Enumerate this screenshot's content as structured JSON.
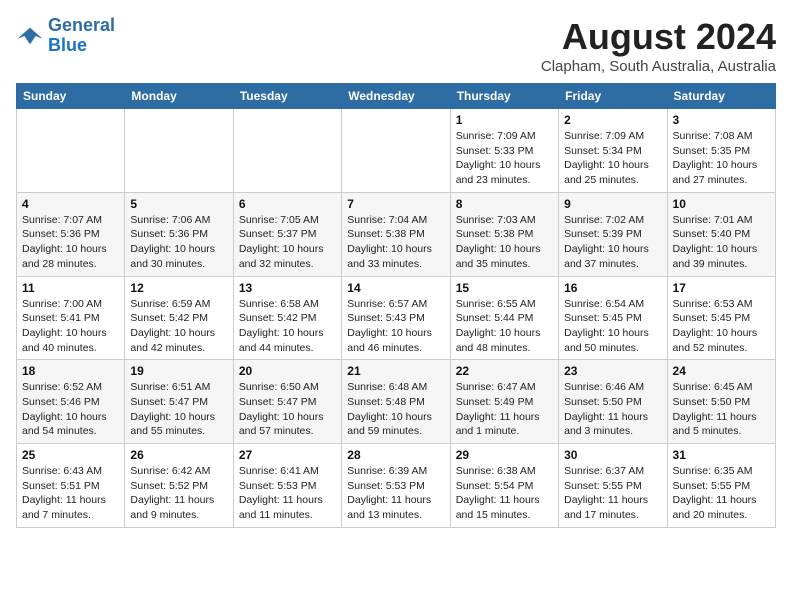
{
  "header": {
    "logo": {
      "line1": "General",
      "line2": "Blue"
    },
    "month": "August 2024",
    "location": "Clapham, South Australia, Australia"
  },
  "weekdays": [
    "Sunday",
    "Monday",
    "Tuesday",
    "Wednesday",
    "Thursday",
    "Friday",
    "Saturday"
  ],
  "weeks": [
    [
      {
        "day": "",
        "info": ""
      },
      {
        "day": "",
        "info": ""
      },
      {
        "day": "",
        "info": ""
      },
      {
        "day": "",
        "info": ""
      },
      {
        "day": "1",
        "info": "Sunrise: 7:09 AM\nSunset: 5:33 PM\nDaylight: 10 hours\nand 23 minutes."
      },
      {
        "day": "2",
        "info": "Sunrise: 7:09 AM\nSunset: 5:34 PM\nDaylight: 10 hours\nand 25 minutes."
      },
      {
        "day": "3",
        "info": "Sunrise: 7:08 AM\nSunset: 5:35 PM\nDaylight: 10 hours\nand 27 minutes."
      }
    ],
    [
      {
        "day": "4",
        "info": "Sunrise: 7:07 AM\nSunset: 5:36 PM\nDaylight: 10 hours\nand 28 minutes."
      },
      {
        "day": "5",
        "info": "Sunrise: 7:06 AM\nSunset: 5:36 PM\nDaylight: 10 hours\nand 30 minutes."
      },
      {
        "day": "6",
        "info": "Sunrise: 7:05 AM\nSunset: 5:37 PM\nDaylight: 10 hours\nand 32 minutes."
      },
      {
        "day": "7",
        "info": "Sunrise: 7:04 AM\nSunset: 5:38 PM\nDaylight: 10 hours\nand 33 minutes."
      },
      {
        "day": "8",
        "info": "Sunrise: 7:03 AM\nSunset: 5:38 PM\nDaylight: 10 hours\nand 35 minutes."
      },
      {
        "day": "9",
        "info": "Sunrise: 7:02 AM\nSunset: 5:39 PM\nDaylight: 10 hours\nand 37 minutes."
      },
      {
        "day": "10",
        "info": "Sunrise: 7:01 AM\nSunset: 5:40 PM\nDaylight: 10 hours\nand 39 minutes."
      }
    ],
    [
      {
        "day": "11",
        "info": "Sunrise: 7:00 AM\nSunset: 5:41 PM\nDaylight: 10 hours\nand 40 minutes."
      },
      {
        "day": "12",
        "info": "Sunrise: 6:59 AM\nSunset: 5:42 PM\nDaylight: 10 hours\nand 42 minutes."
      },
      {
        "day": "13",
        "info": "Sunrise: 6:58 AM\nSunset: 5:42 PM\nDaylight: 10 hours\nand 44 minutes."
      },
      {
        "day": "14",
        "info": "Sunrise: 6:57 AM\nSunset: 5:43 PM\nDaylight: 10 hours\nand 46 minutes."
      },
      {
        "day": "15",
        "info": "Sunrise: 6:55 AM\nSunset: 5:44 PM\nDaylight: 10 hours\nand 48 minutes."
      },
      {
        "day": "16",
        "info": "Sunrise: 6:54 AM\nSunset: 5:45 PM\nDaylight: 10 hours\nand 50 minutes."
      },
      {
        "day": "17",
        "info": "Sunrise: 6:53 AM\nSunset: 5:45 PM\nDaylight: 10 hours\nand 52 minutes."
      }
    ],
    [
      {
        "day": "18",
        "info": "Sunrise: 6:52 AM\nSunset: 5:46 PM\nDaylight: 10 hours\nand 54 minutes."
      },
      {
        "day": "19",
        "info": "Sunrise: 6:51 AM\nSunset: 5:47 PM\nDaylight: 10 hours\nand 55 minutes."
      },
      {
        "day": "20",
        "info": "Sunrise: 6:50 AM\nSunset: 5:47 PM\nDaylight: 10 hours\nand 57 minutes."
      },
      {
        "day": "21",
        "info": "Sunrise: 6:48 AM\nSunset: 5:48 PM\nDaylight: 10 hours\nand 59 minutes."
      },
      {
        "day": "22",
        "info": "Sunrise: 6:47 AM\nSunset: 5:49 PM\nDaylight: 11 hours\nand 1 minute."
      },
      {
        "day": "23",
        "info": "Sunrise: 6:46 AM\nSunset: 5:50 PM\nDaylight: 11 hours\nand 3 minutes."
      },
      {
        "day": "24",
        "info": "Sunrise: 6:45 AM\nSunset: 5:50 PM\nDaylight: 11 hours\nand 5 minutes."
      }
    ],
    [
      {
        "day": "25",
        "info": "Sunrise: 6:43 AM\nSunset: 5:51 PM\nDaylight: 11 hours\nand 7 minutes."
      },
      {
        "day": "26",
        "info": "Sunrise: 6:42 AM\nSunset: 5:52 PM\nDaylight: 11 hours\nand 9 minutes."
      },
      {
        "day": "27",
        "info": "Sunrise: 6:41 AM\nSunset: 5:53 PM\nDaylight: 11 hours\nand 11 minutes."
      },
      {
        "day": "28",
        "info": "Sunrise: 6:39 AM\nSunset: 5:53 PM\nDaylight: 11 hours\nand 13 minutes."
      },
      {
        "day": "29",
        "info": "Sunrise: 6:38 AM\nSunset: 5:54 PM\nDaylight: 11 hours\nand 15 minutes."
      },
      {
        "day": "30",
        "info": "Sunrise: 6:37 AM\nSunset: 5:55 PM\nDaylight: 11 hours\nand 17 minutes."
      },
      {
        "day": "31",
        "info": "Sunrise: 6:35 AM\nSunset: 5:55 PM\nDaylight: 11 hours\nand 20 minutes."
      }
    ]
  ]
}
